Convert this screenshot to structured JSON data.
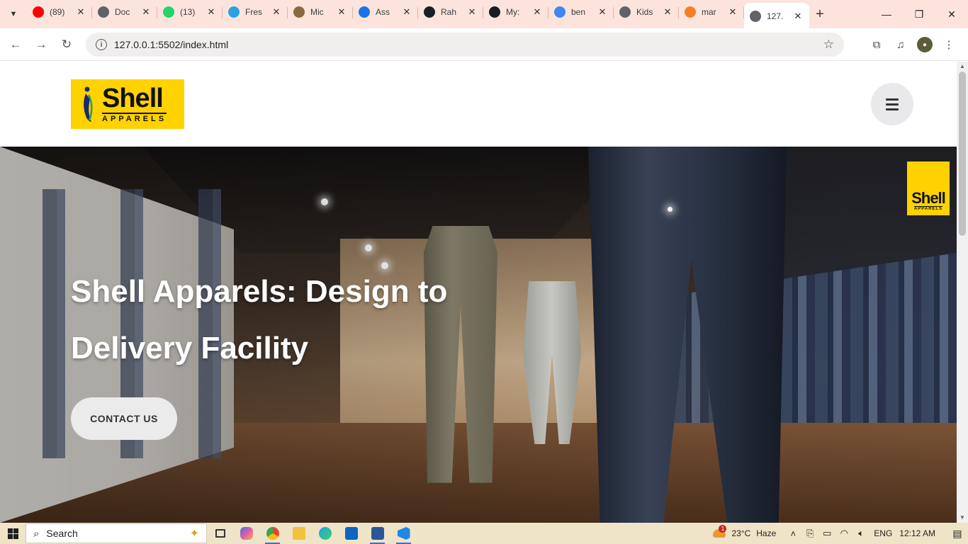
{
  "browser": {
    "tabs": [
      {
        "title": "(89)",
        "icon": "youtube-icon",
        "color": "#ff0000"
      },
      {
        "title": "Doc",
        "icon": "globe-icon",
        "color": "#5f6368"
      },
      {
        "title": "(13)",
        "icon": "whatsapp-icon",
        "color": "#25d366"
      },
      {
        "title": "Fres",
        "icon": "telegram-icon",
        "color": "#2aa3df"
      },
      {
        "title": "Mic",
        "icon": "chatgpt-icon",
        "color": "#8b6a3e"
      },
      {
        "title": "Ass",
        "icon": "link-icon",
        "color": "#1a73e8"
      },
      {
        "title": "Rah",
        "icon": "github-icon",
        "color": "#1b1f23"
      },
      {
        "title": "My:",
        "icon": "github-icon",
        "color": "#1b1f23"
      },
      {
        "title": "ben",
        "icon": "google-icon",
        "color": "#4285f4"
      },
      {
        "title": "Kids",
        "icon": "globe-icon",
        "color": "#5f6368"
      },
      {
        "title": "mar",
        "icon": "stackoverflow-icon",
        "color": "#f48024"
      },
      {
        "title": "127.",
        "icon": "globe-icon",
        "color": "#5f6368",
        "active": true
      }
    ],
    "new_tab": "+",
    "close_glyph": "✕",
    "url": "127.0.0.1:5502/index.html"
  },
  "site": {
    "logo": {
      "word": "Shell",
      "sub": "APPARELS"
    },
    "hero": {
      "title": "Shell Apparels: Design to Delivery Facility",
      "cta": "CONTACT US",
      "store_logo": {
        "word": "Shell",
        "sub": "APPARELS"
      }
    }
  },
  "taskbar": {
    "search_label": "Search",
    "weather": {
      "temp": "23°C",
      "condition": "Haze",
      "alerts": "1"
    },
    "lang": "ENG",
    "time": "12:12 AM"
  }
}
